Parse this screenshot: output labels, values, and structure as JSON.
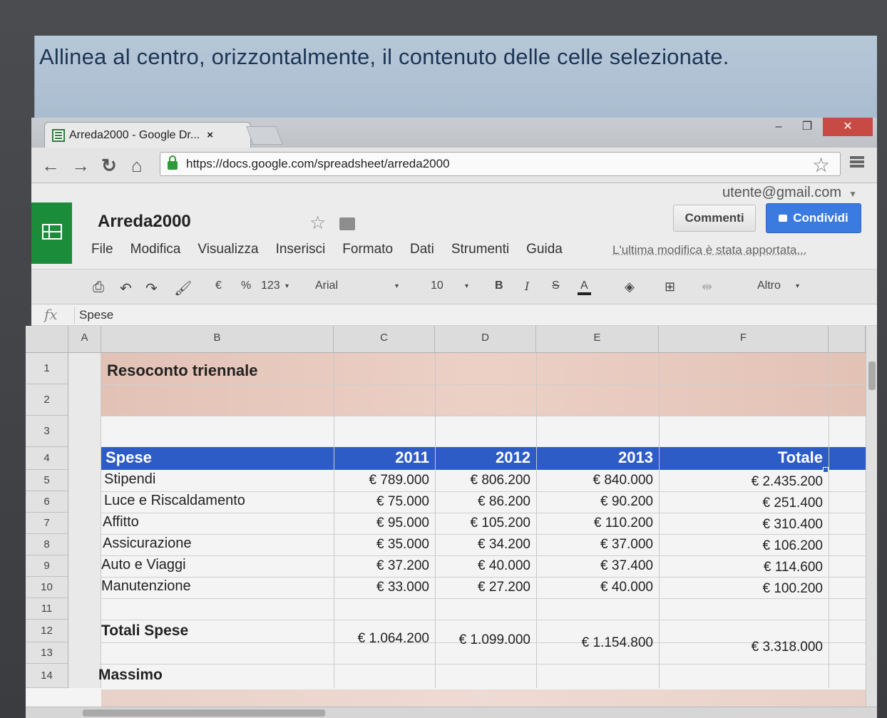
{
  "instruction": "Allinea al centro, orizzontalmente, il contenuto delle celle selezionate.",
  "browser": {
    "tab_title": "Arreda2000 - Google Dr...",
    "tab_close": "×",
    "url": "https://docs.google.com/spreadsheet/arreda2000",
    "window_minimize": "–",
    "window_restore": "❐",
    "window_close": "✕"
  },
  "doc": {
    "user": "utente@gmail.com",
    "title": "Arreda2000",
    "comments_label": "Commenti",
    "share_label": "Condividi",
    "last_edit": "L'ultima modifica è stata apportata..."
  },
  "menu": [
    "File",
    "Modifica",
    "Visualizza",
    "Inserisci",
    "Formato",
    "Dati",
    "Strumenti",
    "Guida"
  ],
  "toolbar": {
    "currency": "€",
    "percent": "%",
    "number_format": "123",
    "font": "Arial",
    "font_size": "10",
    "bold": "B",
    "italic": "I",
    "strike": "S",
    "text_color": "A",
    "more": "Altro"
  },
  "formula_bar": {
    "fx": "fx",
    "value": "Spese"
  },
  "columns": [
    "A",
    "B",
    "C",
    "D",
    "E",
    "F"
  ],
  "rows": [
    "1",
    "2",
    "3",
    "4",
    "5",
    "6",
    "7",
    "8",
    "9",
    "10",
    "11",
    "12",
    "13",
    "14"
  ],
  "sheet": {
    "title": "Resoconto triennale",
    "header": [
      "Spese",
      "2011",
      "2012",
      "2013",
      "Totale"
    ],
    "items": [
      {
        "label": "Stipendi",
        "v2011": "€ 789.000",
        "v2012": "€ 806.200",
        "v2013": "€ 840.000",
        "total": "€ 2.435.200"
      },
      {
        "label": "Luce e Riscaldamento",
        "v2011": "€ 75.000",
        "v2012": "€ 86.200",
        "v2013": "€ 90.200",
        "total": "€ 251.400"
      },
      {
        "label": "Affitto",
        "v2011": "€ 95.000",
        "v2012": "€ 105.200",
        "v2013": "€ 110.200",
        "total": "€ 310.400"
      },
      {
        "label": "Assicurazione",
        "v2011": "€ 35.000",
        "v2012": "€ 34.200",
        "v2013": "€ 37.000",
        "total": "€ 106.200"
      },
      {
        "label": "Auto e Viaggi",
        "v2011": "€ 37.200",
        "v2012": "€ 40.000",
        "v2013": "€ 37.400",
        "total": "€ 114.600"
      },
      {
        "label": "Manutenzione",
        "v2011": "€ 33.000",
        "v2012": "€ 27.200",
        "v2013": "€ 40.000",
        "total": "€ 100.200"
      }
    ],
    "totals": {
      "label": "Totali Spese",
      "v2011": "€ 1.064.200",
      "v2012": "€ 1.099.000",
      "v2013": "€ 1.154.800",
      "total": "€ 3.318.000"
    },
    "max_label": "Massimo"
  },
  "colors": {
    "header_band": "#2e5cc7",
    "title_band": "#e3c2b6",
    "sheets_green": "#1b8c3a",
    "share_blue": "#3b7be0"
  }
}
